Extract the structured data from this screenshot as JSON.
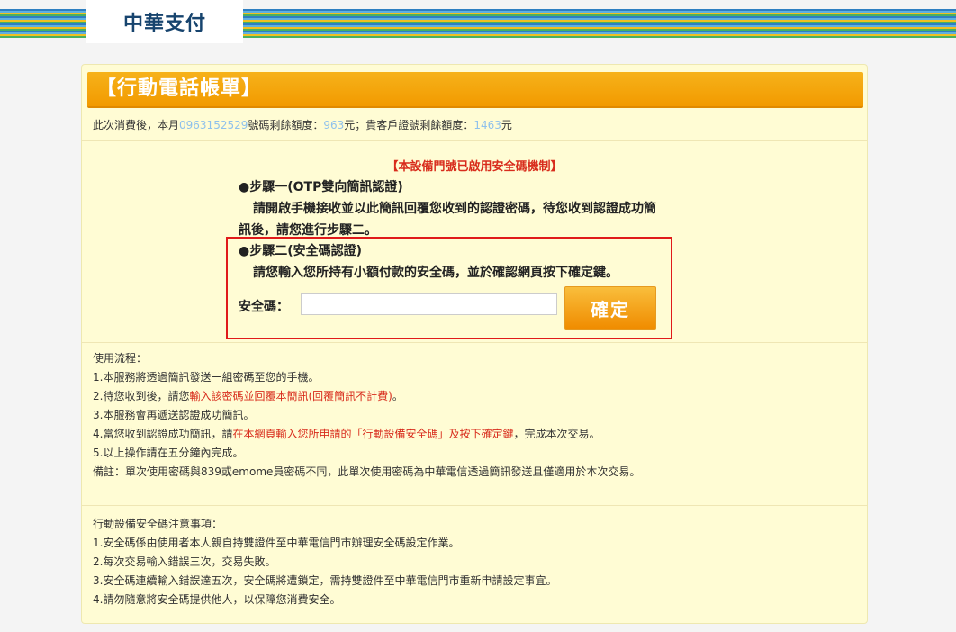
{
  "brand": {
    "name": "中華支付"
  },
  "banner": {
    "title": "【行動電話帳單】"
  },
  "quota": {
    "prefix": "此次消費後，本月",
    "phone_masked": "0963152529",
    "phone_suffix": "號碼剩餘額度：",
    "phone_amount": "963",
    "mid": "元；貴客戶證號剩餘額度：",
    "id_amount": "1463",
    "suffix": "元"
  },
  "notice": "【本設備門號已啟用安全碼機制】",
  "step1": {
    "title": "●步驟一(OTP雙向簡訊認證)",
    "line1": "請開啟手機接收並以此簡訊回覆您收到的認證密碼，待您收到認證成功簡",
    "line2": "訊後，請您進行步驟二。"
  },
  "step2": {
    "title": "●步驟二(安全碼認證)",
    "line1": "請您輸入您所持有小額付款的安全碼，並於確認網頁按下確定鍵。"
  },
  "form": {
    "code_label": "安全碼：",
    "code_value": "",
    "confirm_label": "確定"
  },
  "usage": {
    "heading": "使用流程：",
    "item1": "1.本服務將透過簡訊發送一組密碼至您的手機。",
    "item2_a": "2.待您收到後，請您",
    "item2_red": "輸入該密碼並回覆本簡訊(回覆簡訊不計費)",
    "item2_b": "。",
    "item3": "3.本服務會再遞送認證成功簡訊。",
    "item4_a": "4.當您收到認證成功簡訊，請",
    "item4_red": "在本網頁輸入您所申請的「行動設備安全碼」及按下確定鍵",
    "item4_b": "，完成本次交易。",
    "item5": "5.以上操作請在五分鐘內完成。",
    "remark": "備註：單次使用密碼與839或emome員密碼不同，此單次使用密碼為中華電信透過簡訊發送且僅適用於本次交易。"
  },
  "security": {
    "heading": "行動設備安全碼注意事項：",
    "item1": "1.安全碼係由使用者本人親自持雙證件至中華電信門市辦理安全碼設定作業。",
    "item2": "2.每次交易輸入錯誤三次，交易失敗。",
    "item3": "3.安全碼連續輸入錯誤達五次，安全碼將遭鎖定，需持雙證件至中華電信門市重新申請設定事宜。",
    "item4": "4.請勿隨意將安全碼提供他人，以保障您消費安全。"
  },
  "colors": {
    "banner": "#f4a30e",
    "panel": "#fffcd4",
    "notice_red": "#d82c1c",
    "brand_blue": "#17446e"
  }
}
